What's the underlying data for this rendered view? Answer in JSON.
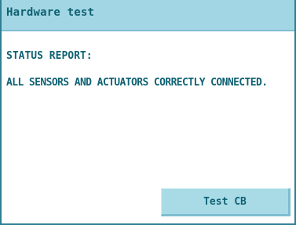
{
  "window": {
    "title": "Hardware test"
  },
  "status": {
    "heading": "STATUS REPORT:",
    "message": "ALL SENSORS AND ACTUATORS CORRECTLY CONNECTED."
  },
  "actions": {
    "test_button_label": "Test CB"
  },
  "colors": {
    "title_bar": "#a3d6e4",
    "text": "#0f6273",
    "button": "#a9dbe6",
    "frame": "#2e7f91"
  }
}
